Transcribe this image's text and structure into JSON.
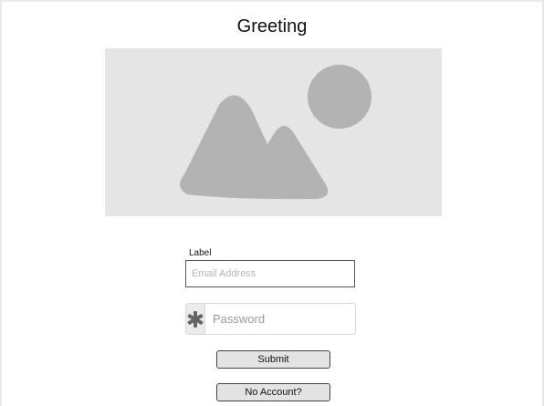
{
  "header": {
    "title": "Greeting"
  },
  "hero": {
    "icon": "image-placeholder-icon",
    "background_color": "#e5e5e5",
    "icon_color": "#b3b3b3"
  },
  "form": {
    "email": {
      "label": "Label",
      "placeholder": "Email Address",
      "value": ""
    },
    "password": {
      "icon": "asterisk-icon",
      "placeholder": "Password",
      "value": ""
    },
    "submit_label": "Submit",
    "no_account_label": "No Account?"
  },
  "colors": {
    "page_background": "#ffffff",
    "button_background": "#e3e3e3",
    "addon_background": "#ebebeb"
  }
}
